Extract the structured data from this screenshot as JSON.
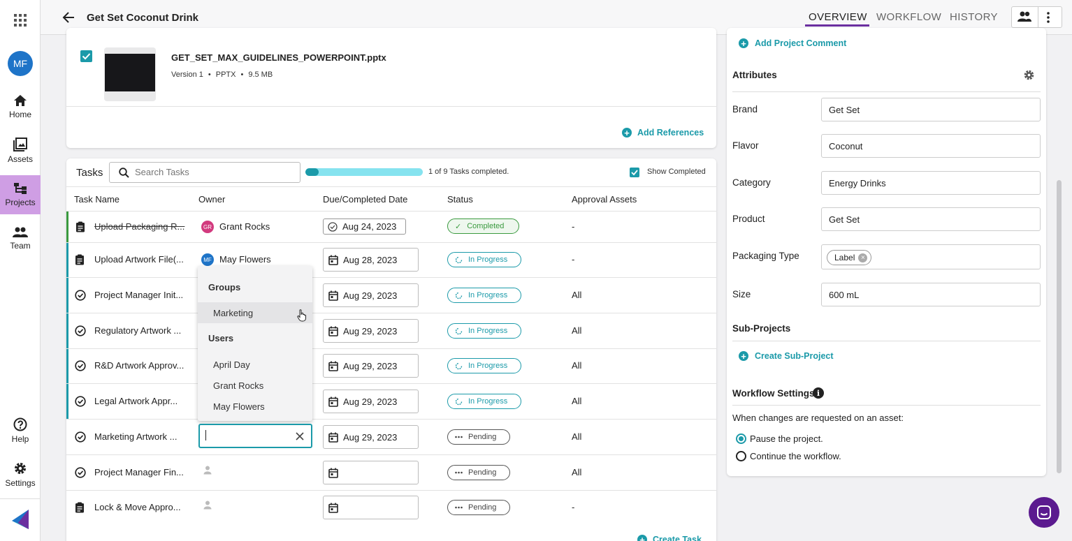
{
  "app": {
    "avatar_initials": "MF",
    "project_title": "Get Set Coconut Drink"
  },
  "sidebar": {
    "items": [
      {
        "label": "Home",
        "icon": "home-icon"
      },
      {
        "label": "Assets",
        "icon": "assets-icon"
      },
      {
        "label": "Projects",
        "icon": "projects-icon"
      },
      {
        "label": "Team",
        "icon": "team-icon"
      },
      {
        "label": "Help",
        "icon": "help-icon"
      },
      {
        "label": "Settings",
        "icon": "gear-icon"
      }
    ]
  },
  "topbar": {
    "tabs": [
      "OVERVIEW",
      "WORKFLOW",
      "HISTORY"
    ],
    "active_tab": "OVERVIEW"
  },
  "reference": {
    "filename": "GET_SET_MAX_GUIDELINES_POWERPOINT.pptx",
    "version": "Version 1",
    "type": "PPTX",
    "size": "9.5 MB",
    "add_references": "Add References"
  },
  "tasks": {
    "title": "Tasks",
    "search_placeholder": "Search Tasks",
    "progress_fraction": 0.111,
    "progress_text": "1 of 9 Tasks completed.",
    "show_completed": "Show Completed",
    "columns": [
      "Task Name",
      "Owner",
      "Due/Completed Date",
      "Status",
      "Approval Assets"
    ],
    "rows": [
      {
        "name": "Upload Packaging R...",
        "owner": "Grant Rocks",
        "owner_initials": "GR",
        "date": "Aug 24, 2023",
        "status": "Completed",
        "approval": "-"
      },
      {
        "name": "Upload Artwork File(...",
        "owner": "May Flowers",
        "owner_initials": "MF",
        "date": "Aug 28, 2023",
        "status": "In Progress",
        "approval": "-"
      },
      {
        "name": "Project Manager Init...",
        "owner": "",
        "date": "Aug 29, 2023",
        "status": "In Progress",
        "approval": "All"
      },
      {
        "name": "Regulatory Artwork ...",
        "owner": "",
        "date": "Aug 29, 2023",
        "status": "In Progress",
        "approval": "All"
      },
      {
        "name": "R&D Artwork Approv...",
        "owner": "",
        "date": "Aug 29, 2023",
        "status": "In Progress",
        "approval": "All"
      },
      {
        "name": "Legal Artwork Appr...",
        "owner": "",
        "date": "Aug 29, 2023",
        "status": "In Progress",
        "approval": "All"
      },
      {
        "name": "Marketing Artwork ...",
        "owner": "",
        "date": "Aug 29, 2023",
        "status": "Pending",
        "approval": "All"
      },
      {
        "name": "Project Manager Fin...",
        "owner": "",
        "date": "",
        "status": "Pending",
        "approval": "All"
      },
      {
        "name": "Lock & Move Appro...",
        "owner": "",
        "date": "",
        "status": "Pending",
        "approval": "-"
      }
    ],
    "create_task": "Create Task"
  },
  "owner_dropdown": {
    "groups_header": "Groups",
    "groups": [
      "Marketing"
    ],
    "users_header": "Users",
    "users": [
      "April Day",
      "Grant Rocks",
      "May Flowers"
    ],
    "input_value": ""
  },
  "right_panel": {
    "add_comment": "Add Project Comment",
    "attributes_title": "Attributes",
    "attributes": [
      {
        "label": "Brand",
        "value": "Get Set"
      },
      {
        "label": "Flavor",
        "value": "Coconut"
      },
      {
        "label": "Category",
        "value": "Energy Drinks"
      },
      {
        "label": "Product",
        "value": "Get Set"
      },
      {
        "label": "Packaging Type",
        "chip": "Label"
      },
      {
        "label": "Size",
        "value": "600 mL"
      }
    ],
    "subprojects_title": "Sub-Projects",
    "create_subproject": "Create Sub-Project",
    "workflow_title": "Workflow Settings",
    "workflow_question": "When changes are requested on an asset:",
    "options": [
      "Pause the project.",
      "Continue the workflow."
    ],
    "selected_option": 0
  },
  "colors": {
    "accent": "#1b9aa9",
    "projects_active": "#cf9ee4",
    "chat": "#5b1a8f"
  }
}
